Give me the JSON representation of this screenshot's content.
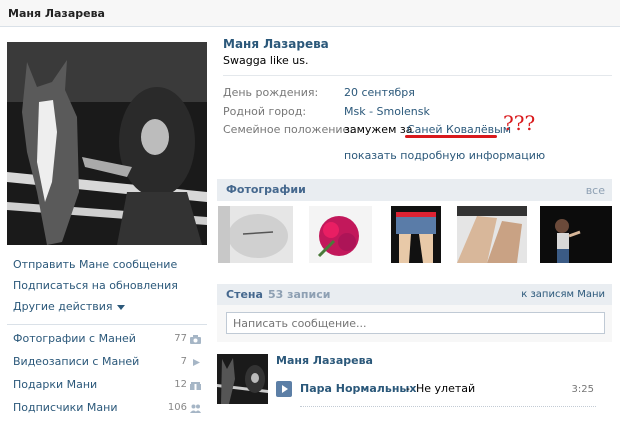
{
  "window": {
    "title": "Маня Лазарева"
  },
  "profile": {
    "name": "Маня Лазарева",
    "status": "Swagga like us.",
    "info": [
      {
        "label": "День рождения:",
        "value": "20 сентября"
      },
      {
        "label": "Родной город:",
        "value": "Msk - Smolensk"
      },
      {
        "label": "Семейное положение:",
        "value_prefix": "замужем за",
        "value_link": "Саней Ковалёвым"
      }
    ],
    "annotation": "???",
    "more_link": "показать подробную информацию"
  },
  "left": {
    "actions": [
      "Отправить Мане сообщение",
      "Подписаться на обновления",
      "Другие действия"
    ],
    "counters": [
      {
        "label": "Фотографии с Маней",
        "count": "77",
        "icon": "camera-icon"
      },
      {
        "label": "Видеозаписи с Маней",
        "count": "7",
        "icon": "video-icon"
      },
      {
        "label": "Подарки Мани",
        "count": "12",
        "icon": "gift-icon"
      },
      {
        "label": "Подписчики Мани",
        "count": "106",
        "icon": "people-icon"
      }
    ]
  },
  "photos": {
    "header": "Фотографии",
    "all_link": "все"
  },
  "wall": {
    "header": "Стена",
    "count": "53 записи",
    "to_link": "к записям Мани",
    "placeholder": "Написать сообщение...",
    "post": {
      "author": "Маня Лазарева",
      "audio": {
        "artist": "Пара Нормальных",
        "separator": "-",
        "title": "Не улетай",
        "duration": "3:25"
      }
    }
  },
  "colors": {
    "link": "#2B587A",
    "header_bg": "#e9edf1",
    "annotation": "#d9191c"
  }
}
